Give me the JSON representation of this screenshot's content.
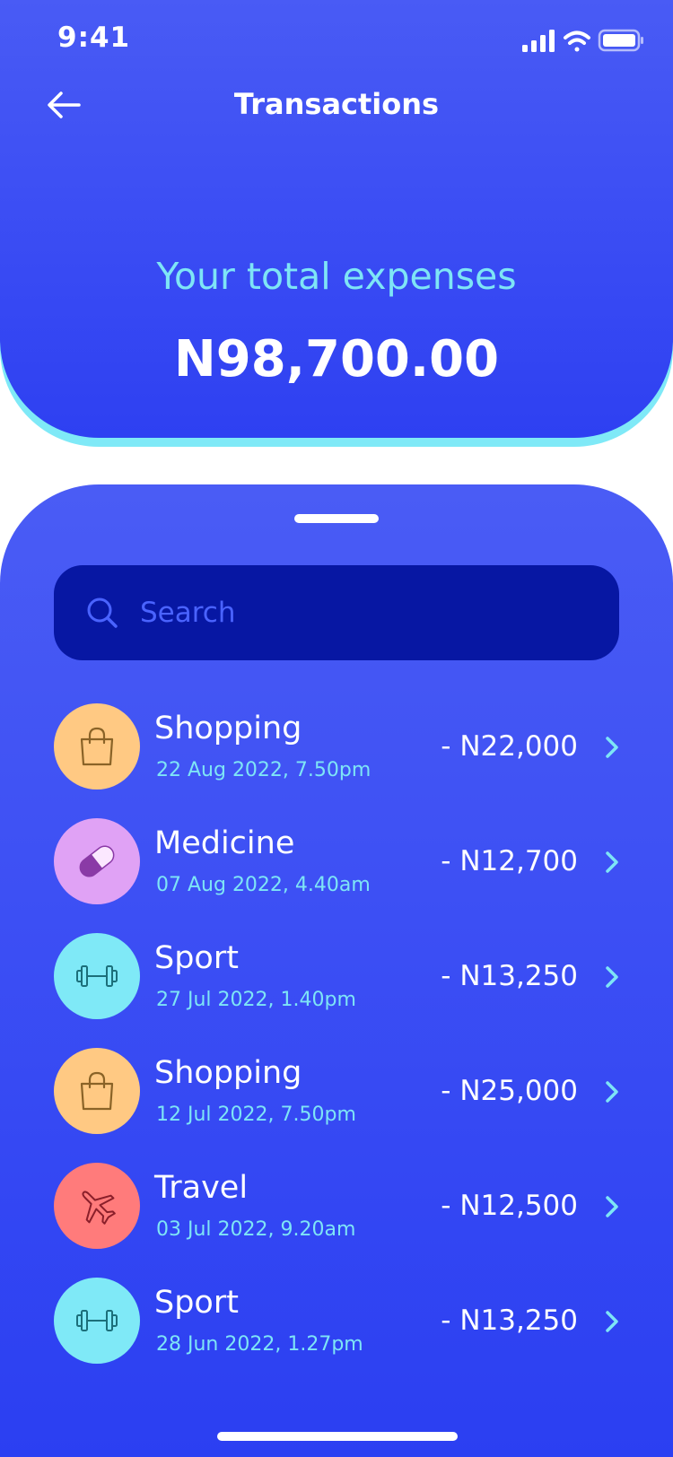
{
  "status_bar": {
    "time": "9:41"
  },
  "header": {
    "title": "Transactions",
    "expenses_label": "Your total expenses",
    "expenses_amount": "N98,700.00"
  },
  "search": {
    "placeholder": "Search",
    "value": ""
  },
  "colors": {
    "accent_blue": "#3345f4",
    "search_bg": "#0717a3",
    "cyan_text": "#7ee5f6",
    "shopping_bg": "#ffc983",
    "medicine_bg": "#e0a2f5",
    "sport_bg": "#7fe9f7",
    "travel_bg": "#ff7b7b"
  },
  "transactions": [
    {
      "category": "Shopping",
      "date": "22 Aug 2022, 7.50pm",
      "amount": "- N22,000",
      "icon": "shopping-bag-icon"
    },
    {
      "category": "Medicine",
      "date": "07 Aug 2022, 4.40am",
      "amount": "- N12,700",
      "icon": "pill-icon"
    },
    {
      "category": "Sport",
      "date": "27 Jul 2022, 1.40pm",
      "amount": "- N13,250",
      "icon": "dumbbell-icon"
    },
    {
      "category": "Shopping",
      "date": "12 Jul 2022, 7.50pm",
      "amount": "- N25,000",
      "icon": "shopping-bag-icon"
    },
    {
      "category": "Travel",
      "date": "03 Jul 2022, 9.20am",
      "amount": "- N12,500",
      "icon": "airplane-icon"
    },
    {
      "category": "Sport",
      "date": "28 Jun 2022, 1.27pm",
      "amount": "- N13,250",
      "icon": "dumbbell-icon"
    }
  ]
}
